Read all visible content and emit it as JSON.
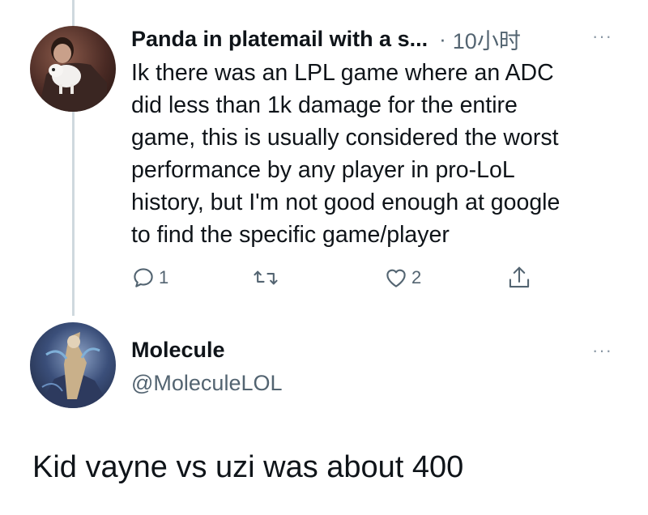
{
  "tweet1": {
    "author_name": "Panda in platemail with a s...",
    "time": "10小时",
    "text": "Ik there was an LPL game where an ADC\ndid less than 1k damage for the entire\ngame, this is usually considered the worst\nperformance by any player in pro-LoL\nhistory, but I'm not good enough at google\nto find the specific game/player",
    "reply_count": "1",
    "like_count": "2",
    "more_label": "···",
    "separator": "·"
  },
  "tweet2": {
    "author_name": "Molecule",
    "handle": "@MoleculeLOL",
    "more_label": "···",
    "text": "Kid vayne vs uzi was about 400"
  },
  "icons": {
    "reply": "reply-icon",
    "retweet": "retweet-icon",
    "like": "like-icon",
    "share": "share-icon"
  },
  "colors": {
    "text": "#0f1419",
    "secondary": "#536471",
    "thread_line": "#cfd9de"
  }
}
